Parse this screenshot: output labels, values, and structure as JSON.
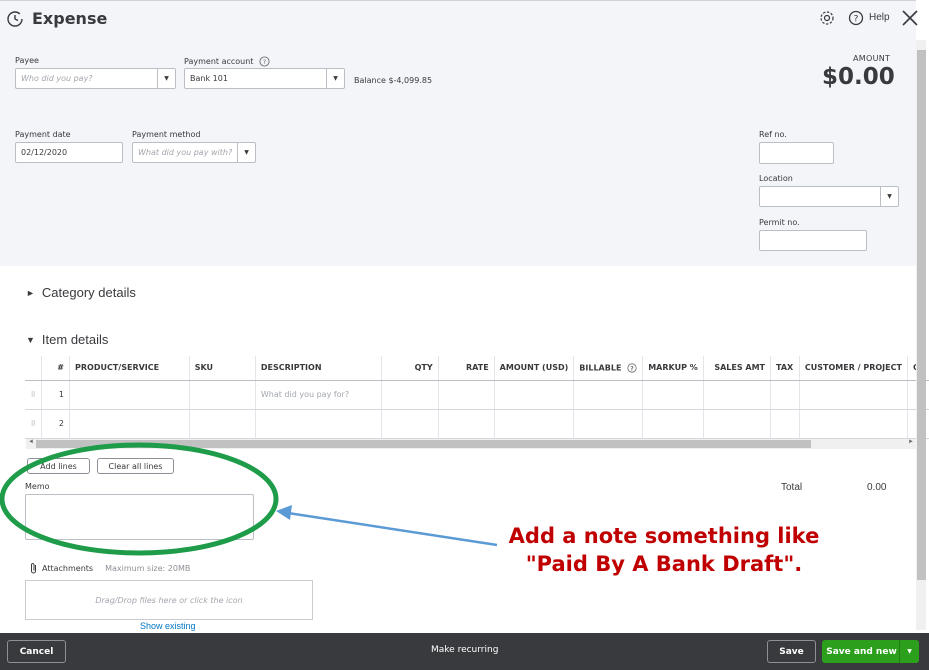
{
  "header": {
    "title": "Expense",
    "help_label": "Help"
  },
  "payee": {
    "label": "Payee",
    "placeholder": "Who did you pay?"
  },
  "payment_account": {
    "label": "Payment account",
    "value": "Bank 101",
    "balance": "Balance $-4,099.85"
  },
  "amount": {
    "label": "AMOUNT",
    "value": "$0.00"
  },
  "payment_date": {
    "label": "Payment date",
    "value": "02/12/2020"
  },
  "payment_method": {
    "label": "Payment method",
    "placeholder": "What did you pay with?"
  },
  "ref_no": {
    "label": "Ref no.",
    "value": ""
  },
  "location": {
    "label": "Location",
    "value": ""
  },
  "permit_no": {
    "label": "Permit no.",
    "value": ""
  },
  "category_details": {
    "label": "Category details"
  },
  "item_details": {
    "label": "Item details",
    "columns": [
      "#",
      "PRODUCT/SERVICE",
      "SKU",
      "DESCRIPTION",
      "QTY",
      "RATE",
      "AMOUNT (USD)",
      "BILLABLE",
      "MARKUP %",
      "SALES AMT",
      "TAX",
      "CUSTOMER / PROJECT",
      "CL"
    ],
    "rows": [
      {
        "num": "1",
        "description_placeholder": "What did you pay for?"
      },
      {
        "num": "2",
        "description_placeholder": ""
      }
    ]
  },
  "buttons": {
    "add_lines": "Add lines",
    "clear_all_lines": "Clear all lines"
  },
  "total": {
    "label": "Total",
    "value": "0.00"
  },
  "memo": {
    "label": "Memo",
    "value": ""
  },
  "attachments": {
    "label": "Attachments",
    "max_size": "Maximum size: 20MB",
    "drop_text": "Drag/Drop files here or click the icon",
    "show_existing": "Show existing"
  },
  "footer": {
    "cancel": "Cancel",
    "make_recurring": "Make recurring",
    "save": "Save",
    "save_and_new": "Save and new"
  },
  "annotation": {
    "line1": "Add a note something like",
    "line2": "\"Paid By A Bank Draft\".",
    "color": "#c00000",
    "ellipse_color": "#1e9c4a",
    "arrow_color": "#5b9bd5"
  }
}
